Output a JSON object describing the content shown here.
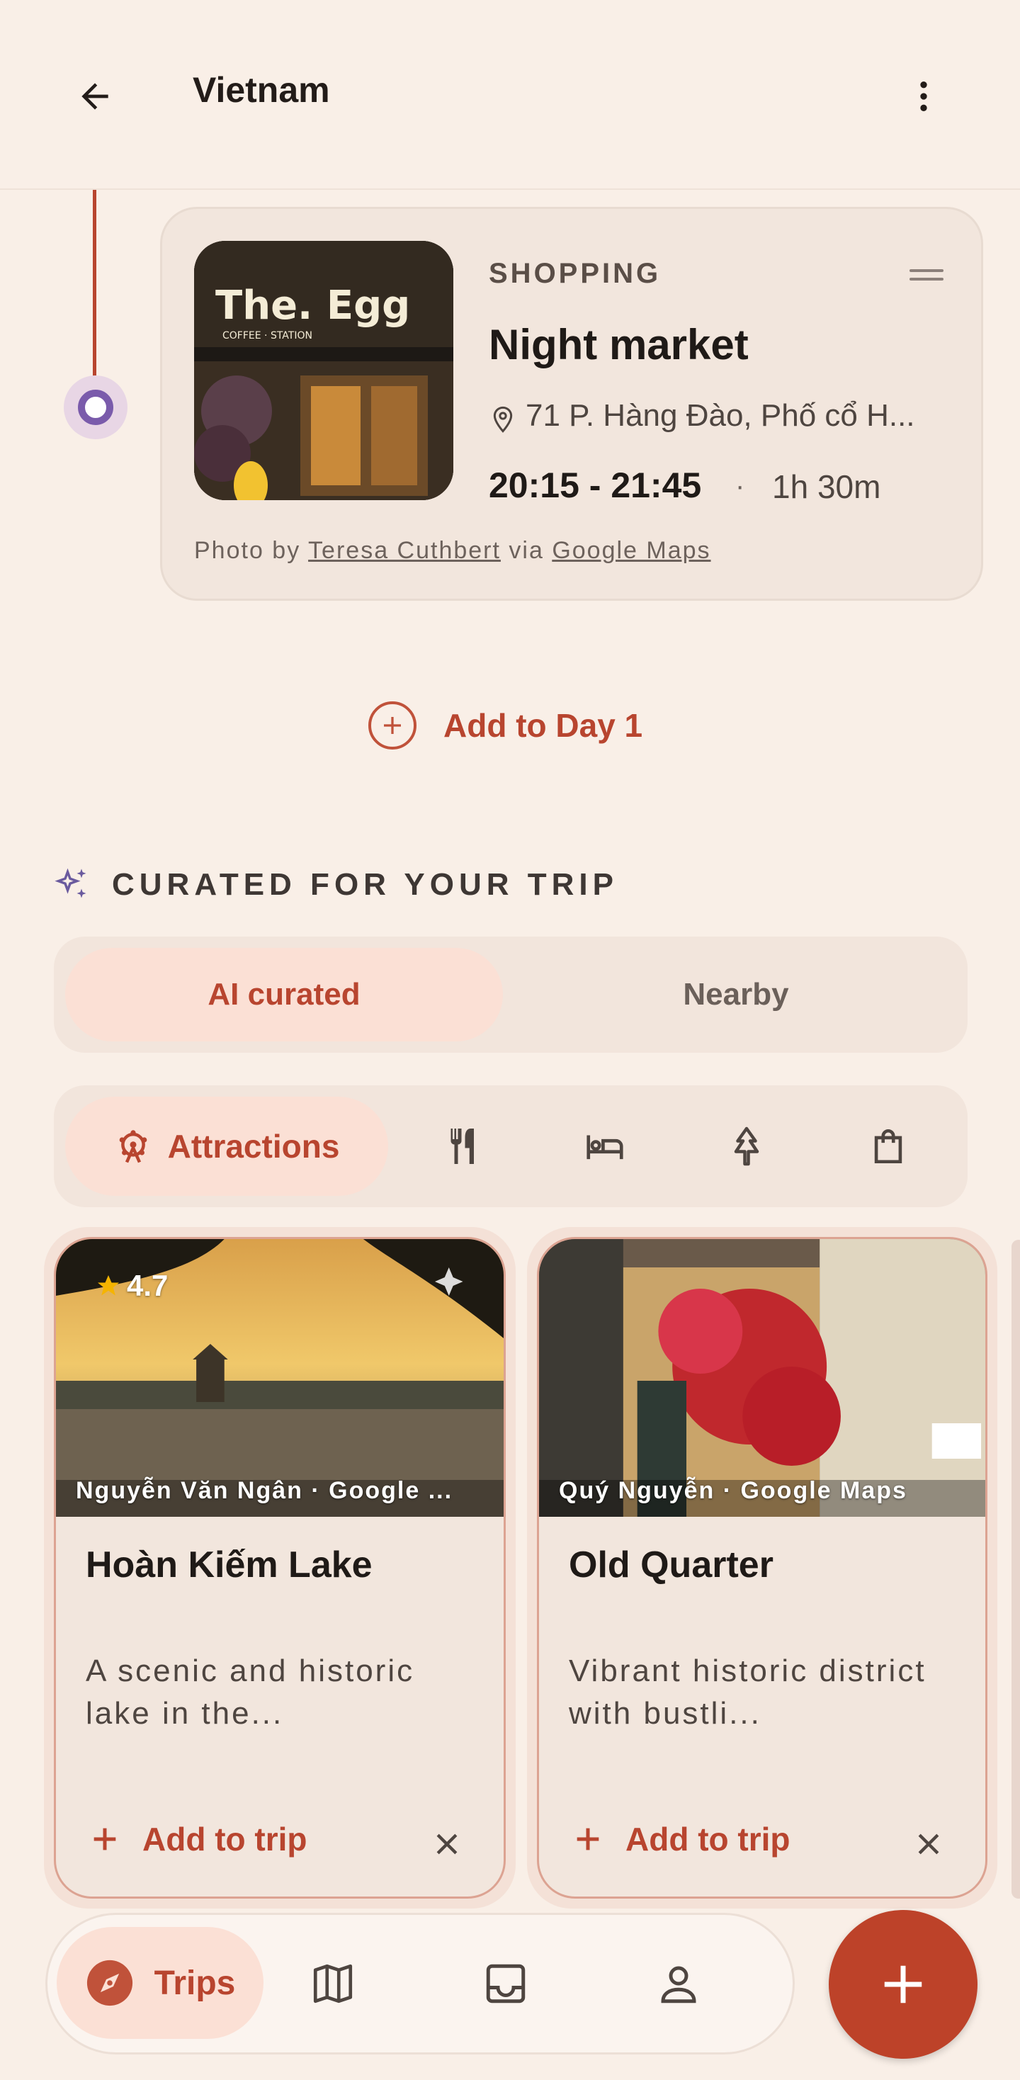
{
  "app_bar": {
    "title": "Vietnam",
    "back_icon": "arrow-back-icon",
    "more_icon": "more-vert-icon"
  },
  "activity": {
    "category": "SHOPPING",
    "name": "Night market",
    "address": "71 P. Hàng Đào, Phố cổ H...",
    "time": "20:15 - 21:45",
    "separator": "·",
    "duration": "1h 30m",
    "photo_credit_prefix": "Photo by ",
    "photo_author": "Teresa Cuthbert",
    "photo_credit_via": " via ",
    "photo_source": "Google Maps",
    "photo_sign_text": "The. Egg",
    "photo_sign_sub": "COFFEE · STATION"
  },
  "add_to_day": {
    "label": "Add to Day 1"
  },
  "curated": {
    "title": "CURATED FOR YOUR TRIP",
    "tabs": [
      {
        "label": "AI curated",
        "active": true
      },
      {
        "label": "Nearby",
        "active": false
      }
    ],
    "categories": [
      {
        "label": "Attractions",
        "icon": "ferris-wheel-icon",
        "active": true
      },
      {
        "icon": "restaurant-icon"
      },
      {
        "icon": "hotel-icon"
      },
      {
        "icon": "park-icon"
      },
      {
        "icon": "shopping-bag-icon"
      }
    ]
  },
  "suggestions": [
    {
      "rating": "4.7",
      "credit": "Nguyễn Văn Ngân · Google ...",
      "name": "Hoàn Kiếm Lake",
      "description": "A scenic and historic lake in the...",
      "add_label": "Add to trip"
    },
    {
      "credit": "Quý Nguyễn · Google Maps",
      "name": "Old Quarter",
      "description": "Vibrant historic district with bustli...",
      "add_label": "Add to trip"
    }
  ],
  "bottom_nav": {
    "items": [
      {
        "label": "Trips",
        "icon": "compass-icon",
        "active": true
      },
      {
        "icon": "map-icon"
      },
      {
        "icon": "inbox-icon"
      },
      {
        "icon": "person-icon"
      }
    ],
    "fab_icon": "add-icon"
  },
  "colors": {
    "background": "#f9efe7",
    "accent": "#b8452f",
    "timeline_dot": "#7a5bab",
    "chip_active": "#fbe0d5",
    "fab": "#bd4229"
  }
}
